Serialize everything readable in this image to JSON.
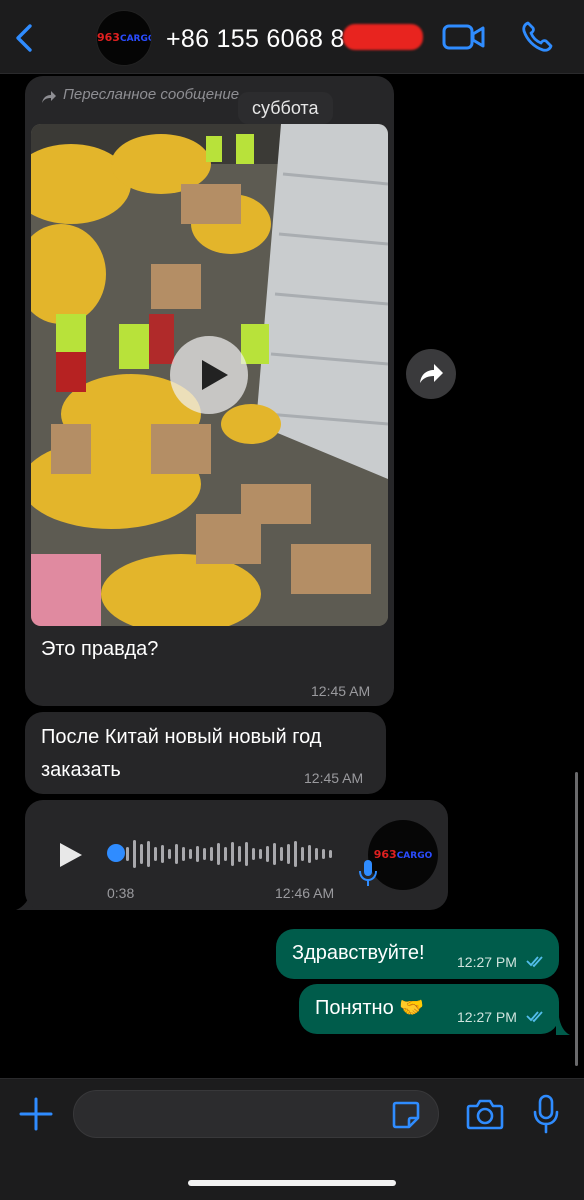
{
  "header": {
    "back_icon": "chevron-left-icon",
    "avatar_logo": {
      "number": "963",
      "word": "CARGO"
    },
    "phone": "+86 155 6068 8",
    "video_icon": "video-camera-icon",
    "call_icon": "phone-icon"
  },
  "messages": {
    "forwarded_label": "Пересланное сообщение",
    "date_divider": "суббота",
    "video_message": {
      "caption": "Это правда?",
      "time": "12:45 AM"
    },
    "text_message": {
      "text": "После Китай новый новый год заказать",
      "time": "12:45 AM"
    },
    "voice_message": {
      "duration": "0:38",
      "time": "12:46 AM",
      "progress": 0
    },
    "outgoing": [
      {
        "text": "Здравствуйте!",
        "time": "12:27 PM",
        "status": "read"
      },
      {
        "text": "Понятно 🤝",
        "time": "12:27 PM",
        "status": "read"
      }
    ]
  },
  "composer": {
    "input_value": "",
    "plus_icon": "plus-icon",
    "sticker_icon": "sticker-icon",
    "camera_icon": "camera-icon",
    "mic_icon": "microphone-icon"
  },
  "colors": {
    "accent": "#2f8cff",
    "outgoing_bubble": "#005c4b",
    "incoming_bubble": "#262628",
    "read_ticks": "#53bdeb"
  }
}
